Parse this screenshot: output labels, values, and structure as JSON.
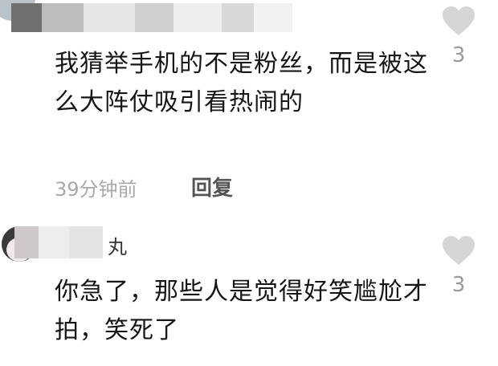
{
  "comments": [
    {
      "text": "我猜举手机的不是粉丝，而是被这么大阵仗吸引看热闹的",
      "timestamp": "39分钟前",
      "reply_label": "回复",
      "likes": "3",
      "like_icon": "heart-icon"
    },
    {
      "username_suffix": "丸",
      "text": "你急了，那些人是觉得好笑尴尬才拍，笑死了",
      "likes": "3",
      "like_icon": "heart-icon"
    }
  ],
  "colors": {
    "text": "#161616",
    "meta": "#a9a9a9",
    "heart": "#d6d6d6",
    "count": "#9a9a9a"
  }
}
